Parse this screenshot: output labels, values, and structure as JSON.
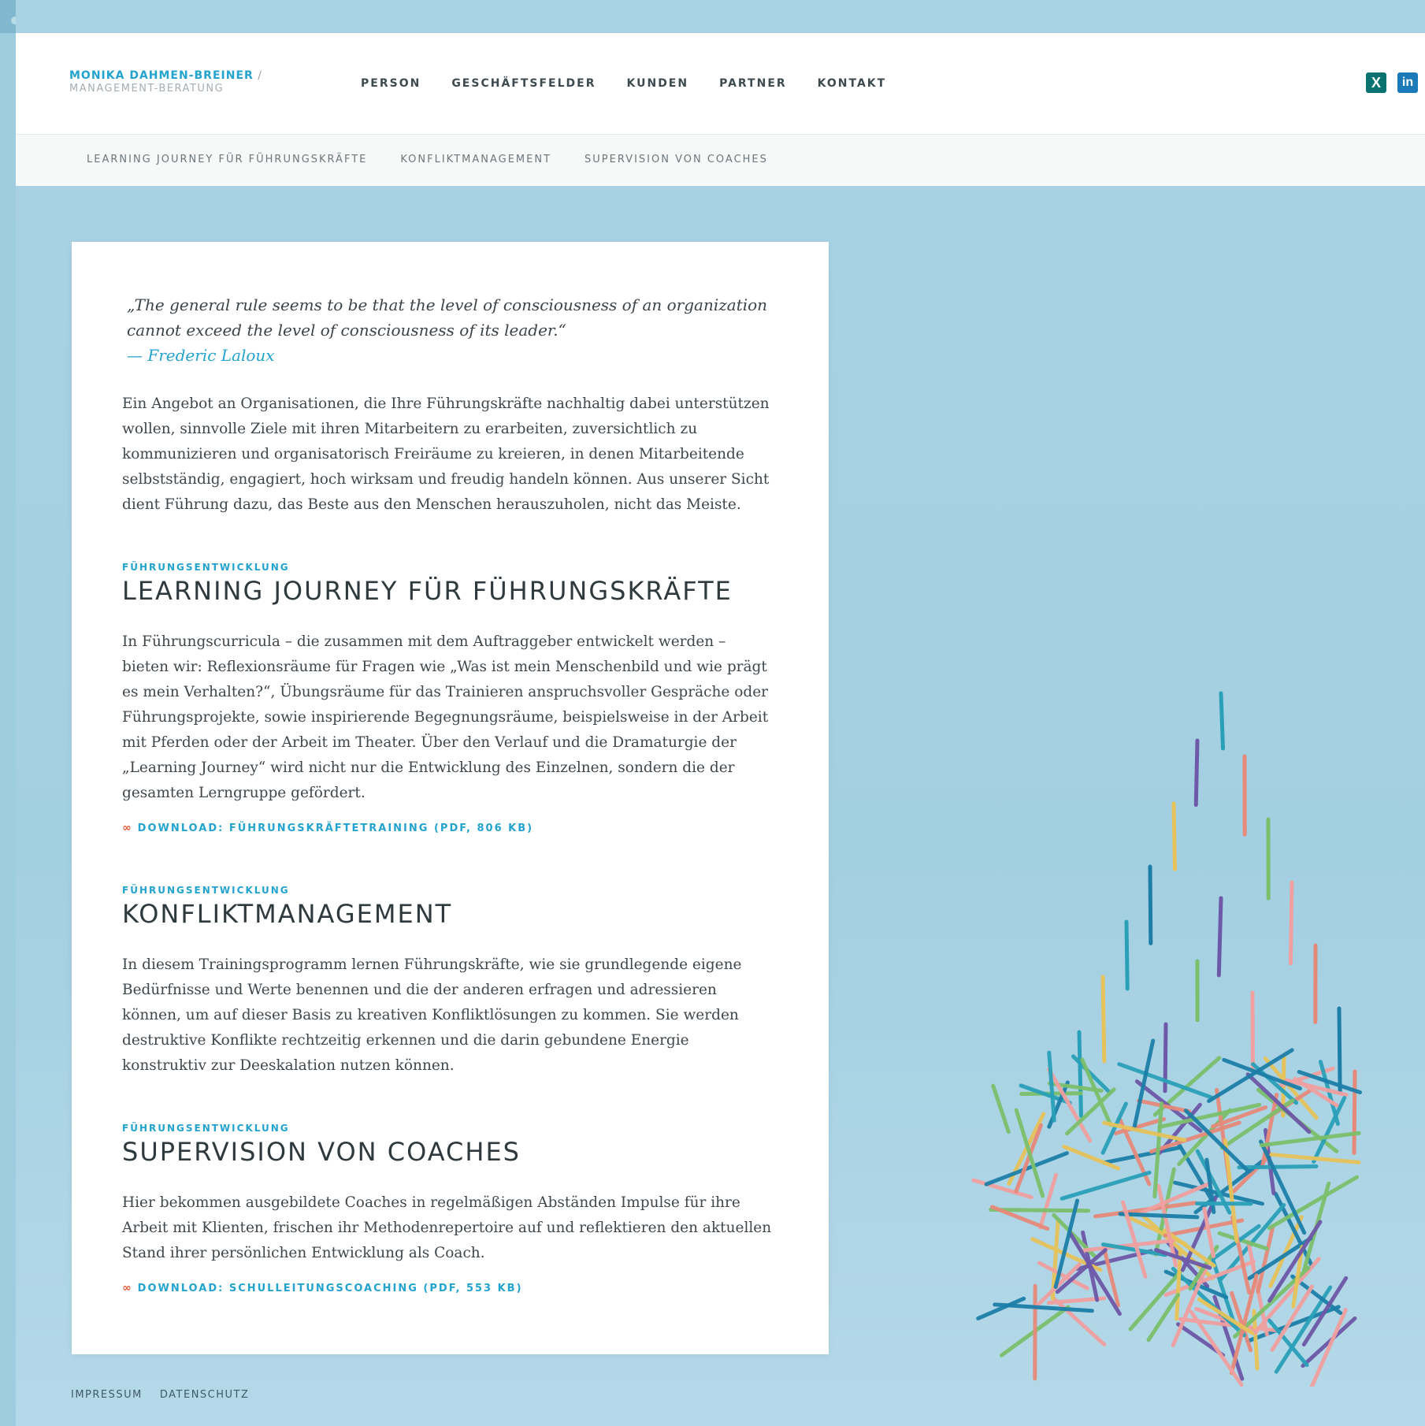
{
  "brand": {
    "name": "MONIKA DAHMEN-BREINER",
    "slash": " /",
    "subtitle": "MANAGEMENT-BERATUNG"
  },
  "main_nav": [
    "PERSON",
    "GESCHÄFTSFELDER",
    "KUNDEN",
    "PARTNER",
    "KONTAKT"
  ],
  "social": {
    "xing_icon": "xing-icon",
    "linkedin_icon": "linkedin-icon"
  },
  "sub_nav": [
    "LEARNING JOURNEY FÜR FÜHRUNGSKRÄFTE",
    "KONFLIKTMANAGEMENT",
    "SUPERVISION VON COACHES"
  ],
  "quote": {
    "text": "„The general rule seems to be that the level of consciousness of an organization cannot exceed the level of consciousness of its leader.“",
    "author": "— Frederic Laloux"
  },
  "intro": "Ein Angebot an Organisationen, die Ihre Führungskräfte nachhaltig dabei unterstützen wollen, sinnvolle Ziele mit ihren Mitarbeitern zu erarbeiten, zuversichtlich zu kommunizieren und organisatorisch Freiräume zu kreieren, in denen Mitarbeitende selbstständig, engagiert, hoch wirksam und freudig handeln können. Aus unserer Sicht dient Führung dazu, das Beste aus den Menschen herauszuholen, nicht das Meiste.",
  "sections": [
    {
      "eyebrow": "FÜHRUNGSENTWICKLUNG",
      "title": "LEARNING JOURNEY FÜR FÜHRUNGSKRÄFTE",
      "text": "In Führungscurricula – die zusammen mit dem Auftraggeber entwickelt werden – bieten wir: Reflexionsräume für Fragen wie „Was ist mein Menschenbild und wie prägt es mein Verhalten?“, Übungsräume für das Trainieren anspruchsvoller Gespräche oder Führungsprojekte, sowie inspirierende Begegnungsräume, beispielsweise in der Arbeit mit Pferden oder der Arbeit im Theater. Über den Verlauf und die Dramaturgie der „Learning Journey“ wird nicht nur die Entwicklung des Einzelnen, sondern die der gesamten Lerngruppe gefördert.",
      "download": "DOWNLOAD: FÜHRUNGSKRÄFTETRAINING (PDF, 806 KB)"
    },
    {
      "eyebrow": "FÜHRUNGSENTWICKLUNG",
      "title": "KONFLIKTMANAGEMENT",
      "text": "In diesem Trainingsprogramm lernen Führungskräfte, wie sie grundlegende eigene Bedürfnisse und Werte benennen und die der anderen erfragen und adressieren können, um auf dieser Basis zu kreativen Konfliktlösungen zu kommen. Sie werden destruktive Konflikte rechtzeitig erkennen und die darin gebundene Energie konstruktiv zur Deeskalation nutzen können.",
      "download": ""
    },
    {
      "eyebrow": "FÜHRUNGSENTWICKLUNG",
      "title": "SUPERVISION VON COACHES",
      "text": "Hier bekommen ausgebildete Coaches in regelmäßigen Abständen Impulse für ihre Arbeit mit Klienten, frischen ihr Methodenrepertoire auf und reflektieren den aktuellen Stand ihrer persönlichen Entwicklung als Coach.",
      "download": "DOWNLOAD: SCHULLEITUNGSCOACHING (PDF, 553 KB)"
    }
  ],
  "footer": [
    "IMPRESSUM",
    "DATENSCHUTZ"
  ],
  "icons": {
    "link": "link-icon",
    "xing_glyph": "X",
    "linkedin_glyph": "in"
  },
  "colors": {
    "accent": "#23a3cf",
    "background": "#a6d0e2",
    "stick_palette": [
      "#2aa0b8",
      "#6e58a8",
      "#e58a7a",
      "#e6c35a",
      "#7cbf6b",
      "#1d7fa8",
      "#f0a0a0"
    ]
  }
}
